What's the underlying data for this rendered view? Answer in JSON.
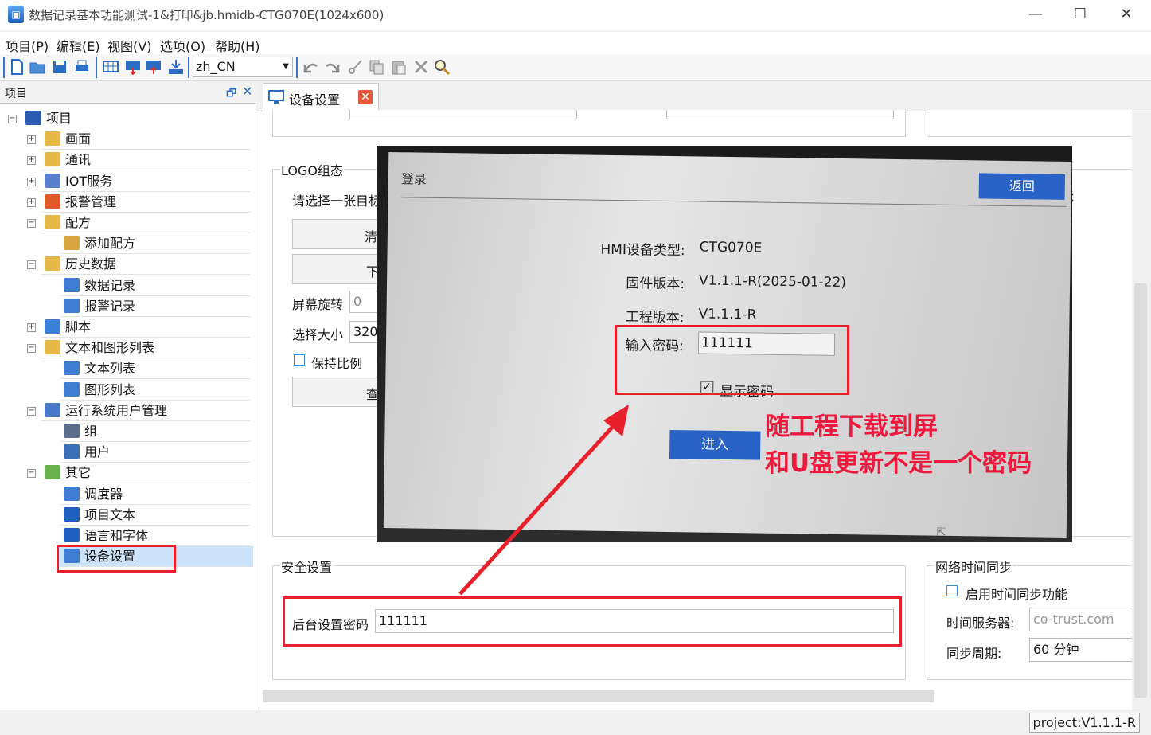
{
  "window": {
    "title": "数据记录基本功能测试-1&打印&jb.hmidb-CTG070E(1024x600)",
    "minimize": "—",
    "maximize": "☐",
    "close": "✕"
  },
  "menu": [
    "项目(P)",
    "编辑(E)",
    "视图(V)",
    "选项(O)",
    "帮助(H)"
  ],
  "toolbar": {
    "language": "zh_CN",
    "icons": [
      "new-icon",
      "open-icon",
      "save-icon",
      "print-icon",
      "screen-grid-icon",
      "download-icon",
      "upload-icon",
      "simulate-icon",
      "undo-icon",
      "redo-icon",
      "cut-icon",
      "copy-icon",
      "paste-icon",
      "delete-icon",
      "find-icon"
    ]
  },
  "tree": {
    "header": "项目",
    "pin": "🗗",
    "close": "✕",
    "items": [
      {
        "label": "项目",
        "level": 0,
        "expander": "−",
        "color": "#2a5db0"
      },
      {
        "label": "画面",
        "level": 1,
        "expander": "+",
        "color": "#e6b84a"
      },
      {
        "label": "通讯",
        "level": 1,
        "expander": "+",
        "color": "#e6b84a"
      },
      {
        "label": "IOT服务",
        "level": 1,
        "expander": "+",
        "color": "#5b7fcf"
      },
      {
        "label": "报警管理",
        "level": 1,
        "expander": "+",
        "color": "#e05a2a"
      },
      {
        "label": "配方",
        "level": 1,
        "expander": "−",
        "color": "#e6b84a"
      },
      {
        "label": "添加配方",
        "level": 2,
        "expander": "",
        "color": "#d8a640"
      },
      {
        "label": "历史数据",
        "level": 1,
        "expander": "−",
        "color": "#e6b84a"
      },
      {
        "label": "数据记录",
        "level": 2,
        "expander": "",
        "color": "#3f7dd0"
      },
      {
        "label": "报警记录",
        "level": 2,
        "expander": "",
        "color": "#3f7dd0"
      },
      {
        "label": "脚本",
        "level": 1,
        "expander": "+",
        "color": "#3b7fd6"
      },
      {
        "label": "文本和图形列表",
        "level": 1,
        "expander": "−",
        "color": "#e6b84a"
      },
      {
        "label": "文本列表",
        "level": 2,
        "expander": "",
        "color": "#3f7dd0"
      },
      {
        "label": "图形列表",
        "level": 2,
        "expander": "",
        "color": "#3f7dd0"
      },
      {
        "label": "运行系统用户管理",
        "level": 1,
        "expander": "−",
        "color": "#4a78c8"
      },
      {
        "label": "组",
        "level": 2,
        "expander": "",
        "color": "#5a6e8c"
      },
      {
        "label": "用户",
        "level": 2,
        "expander": "",
        "color": "#3a6fb8"
      },
      {
        "label": "其它",
        "level": 1,
        "expander": "−",
        "color": "#6ab04c"
      },
      {
        "label": "调度器",
        "level": 2,
        "expander": "",
        "color": "#3f7dd0"
      },
      {
        "label": "项目文本",
        "level": 2,
        "expander": "",
        "color": "#1f5fc0"
      },
      {
        "label": "语言和字体",
        "level": 2,
        "expander": "",
        "color": "#1f5fc0"
      },
      {
        "label": "设备设置",
        "level": 2,
        "expander": "",
        "color": "#3f7dd0",
        "selected": true
      }
    ]
  },
  "tab": {
    "label": "设备设置",
    "close": "✕"
  },
  "logo_group": {
    "title": "LOGO组态",
    "prompt": "请选择一张目标",
    "clear_button": "清",
    "download_button": "下",
    "rotate_label": "屏幕旋转",
    "rotate_value": "0",
    "size_label": "选择大小",
    "size_value": "320",
    "keep_ratio": "保持比例",
    "view_button": "查"
  },
  "right_top_partial": "能",
  "security": {
    "title": "安全设置",
    "password_label": "后台设置密码",
    "password_value": "111111"
  },
  "time_sync": {
    "title": "网络时间同步",
    "enable_label": "启用时间同步功能",
    "server_label": "时间服务器:",
    "server_value": "co-trust.com",
    "period_label": "同步周期:",
    "period_value": "60 分钟"
  },
  "status": {
    "version": "project:V1.1.1-R"
  },
  "photo": {
    "title": "登录",
    "back_button": "返回",
    "device_type_label": "HMI设备类型:",
    "device_type_value": "CTG070E",
    "firmware_label": "固件版本:",
    "firmware_value": "V1.1.1-R(2025-01-22)",
    "project_label": "工程版本:",
    "project_value": "V1.1.1-R",
    "password_label": "输入密码:",
    "password_value": "111111",
    "show_password": "显示密码",
    "check_mark": "✓",
    "enter_button": "进入",
    "cursor": "⇱"
  },
  "annotation": {
    "line1": "随工程下载到屏",
    "line2": "和U盘更新不是一个密码"
  },
  "colors": {
    "accent": "#2a63c7",
    "highlight": "#e8202c",
    "selection": "#cde3f9"
  }
}
